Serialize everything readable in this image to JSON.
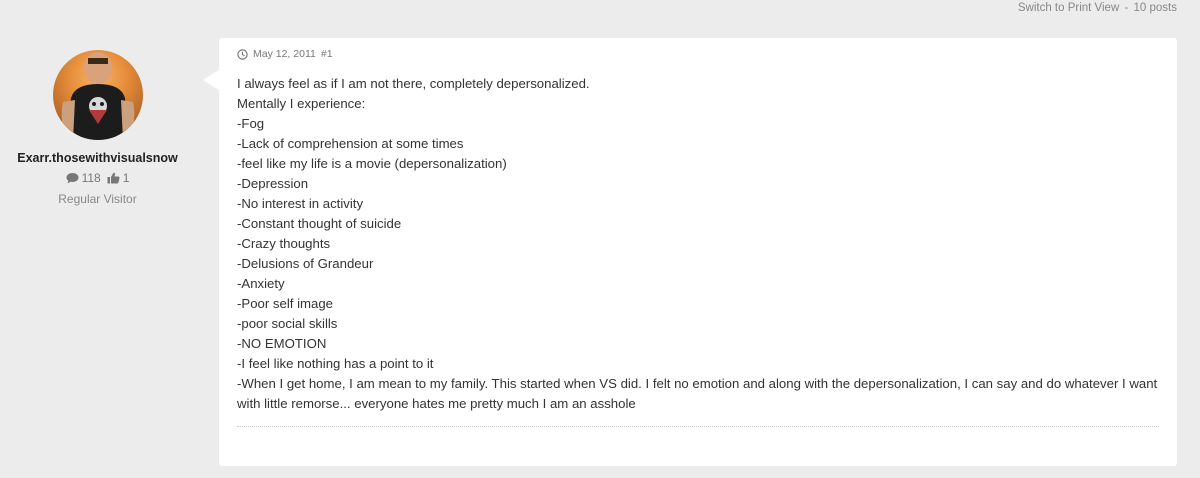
{
  "topbar": {
    "print_link": "Switch to Print View",
    "separator": "-",
    "post_count": "10 posts"
  },
  "author": {
    "name": "Exarr.thosewithvisualsnow",
    "comments_count": "118",
    "likes_count": "1",
    "rank": "Regular Visitor",
    "icons": {
      "comments": "comment-icon",
      "likes": "thumbs-up-icon"
    }
  },
  "post": {
    "date": "May 12, 2011",
    "number": "#1",
    "icon": "clock-icon",
    "lines": [
      "I always feel as if I am not there, completely depersonalized.",
      "Mentally I experience:",
      "-Fog",
      "-Lack of comprehension at some times",
      "-feel like my life is a movie (depersonalization)",
      "-Depression",
      "-No interest in activity",
      "-Constant thought of suicide",
      "-Crazy thoughts",
      "-Delusions of Grandeur",
      "-Anxiety",
      "-Poor self image",
      "-poor social skills",
      "-NO EMOTION",
      "-I feel like nothing has a point to it",
      "-When I get home, I am mean to my family. This started when VS did. I felt no emotion and along with the depersonalization, I can say and do whatever I want",
      "with little remorse... everyone hates me pretty much I am an asshole"
    ]
  }
}
